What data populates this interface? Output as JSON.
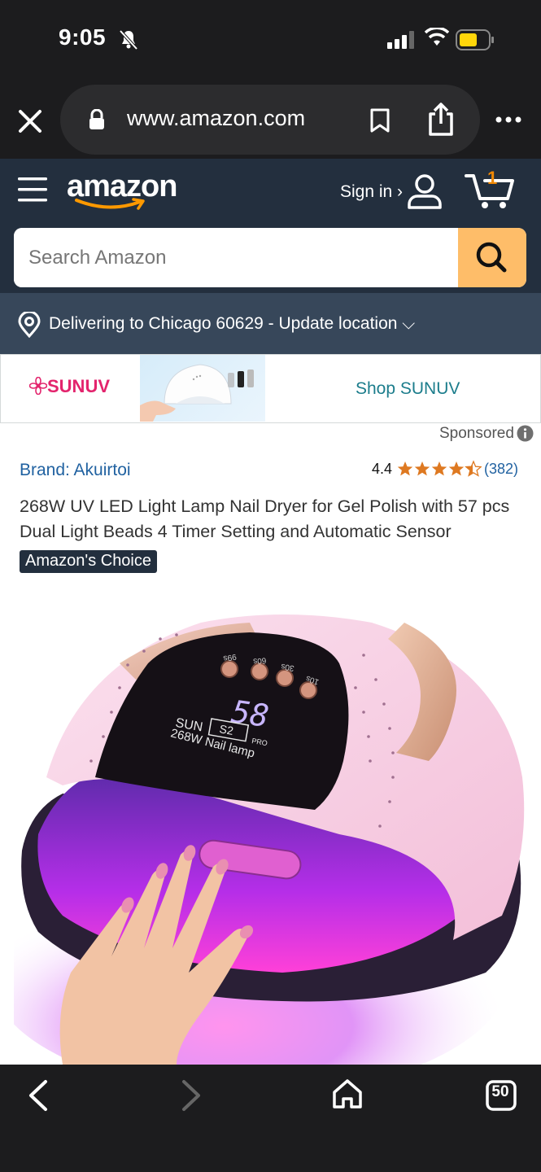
{
  "status_bar": {
    "time": "9:05"
  },
  "browser": {
    "url": "www.amazon.com",
    "tab_count": "50"
  },
  "header": {
    "logo": "amazon",
    "signin_label": "Sign in ›",
    "cart_count": "1",
    "search_placeholder": "Search Amazon"
  },
  "delivery": {
    "text": "Delivering to Chicago 60629 - Update location ⌵"
  },
  "banner": {
    "brand": "SUNUV",
    "link": "Shop SUNUV",
    "sponsored": "Sponsored"
  },
  "product": {
    "brand": "Brand: Akuirtoi",
    "rating": "4.4",
    "rating_value": 4.4,
    "reviews": "(382)",
    "title": "268W UV LED Light Lamp Nail Dryer for Gel Polish with 57 pcs Dual Light Beads 4 Timer Setting and Automatic Sensor",
    "badge": "Amazon's Choice",
    "image_text": {
      "timers": [
        "99s",
        "60s",
        "30s",
        "10s"
      ],
      "display": "58",
      "model_line1": "SUN",
      "model_box": "S2",
      "model_pro": "PRO",
      "model_line2": "268W Nail lamp"
    }
  },
  "colors": {
    "header": "#232f3e",
    "delivery": "#37475a",
    "search_button": "#febd69",
    "star": "#de7921",
    "link": "#2162a1"
  }
}
